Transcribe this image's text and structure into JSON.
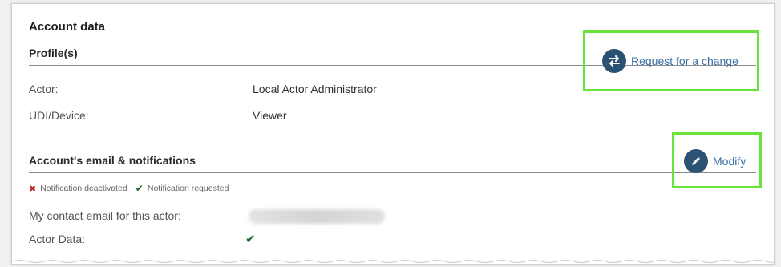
{
  "panel": {
    "title": "Account data"
  },
  "profiles": {
    "heading": "Profile(s)",
    "action_label": "Request for a change",
    "action_icon": "swap-arrows-icon",
    "rows": [
      {
        "label": "Actor:",
        "value": "Local Actor Administrator"
      },
      {
        "label": "UDI/Device:",
        "value": "Viewer"
      }
    ]
  },
  "notifications": {
    "heading": "Account's email & notifications",
    "action_label": "Modify",
    "action_icon": "pencil-icon",
    "legend": {
      "deactivated": "Notification deactivated",
      "requested": "Notification requested"
    },
    "contact_email_label": "My contact email for this actor:",
    "actor_data_label": "Actor Data:",
    "actor_data_status": "requested"
  },
  "colors": {
    "link": "#3b6ea5",
    "icon_bg": "#2b5272",
    "highlight": "#67e33c",
    "deactivated": "#b8261d",
    "requested": "#1d6b2c"
  }
}
